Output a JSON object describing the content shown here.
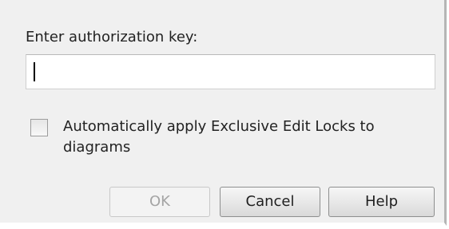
{
  "authorization": {
    "label": "Enter authorization key:",
    "value": "",
    "placeholder": ""
  },
  "exclusive_locks": {
    "label": "Automatically apply Exclusive Edit Locks to diagrams",
    "checked": false
  },
  "buttons": {
    "ok": "OK",
    "ok_enabled": false,
    "cancel": "Cancel",
    "help": "Help"
  },
  "colors": {
    "dialog_background": "#f0f0f0",
    "input_background": "#ffffff",
    "disabled_text": "#a4a4a4"
  }
}
